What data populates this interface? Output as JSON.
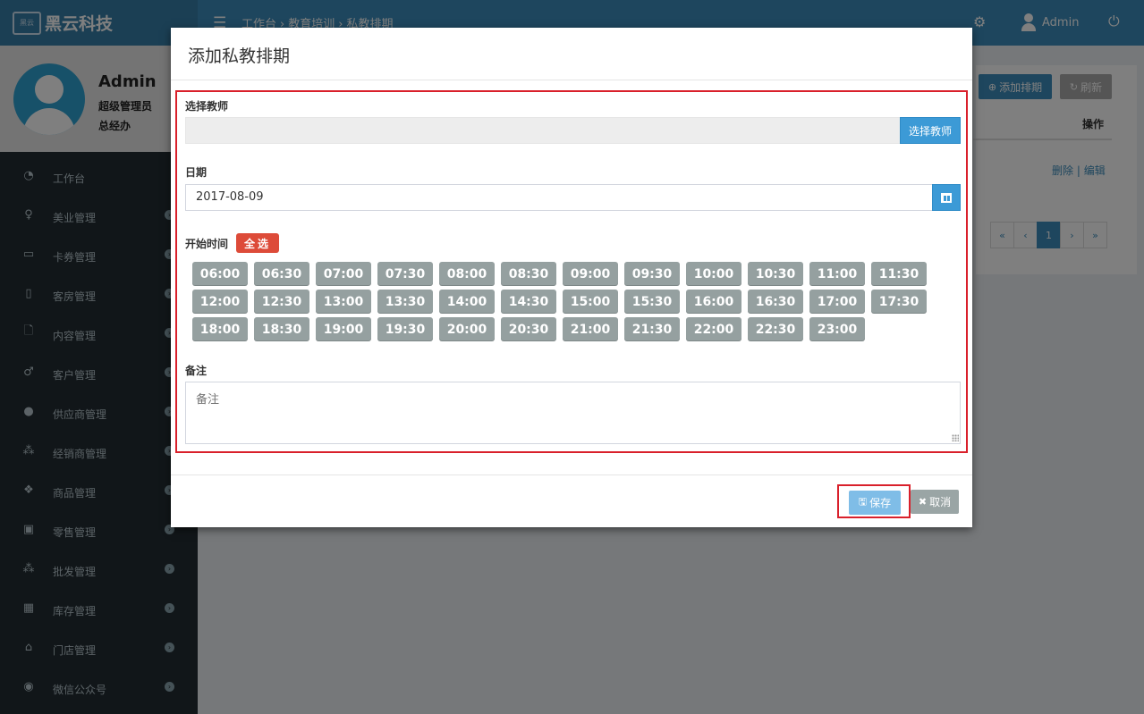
{
  "header": {
    "logo_badge": "黑云",
    "logo_text": "黑云科技",
    "breadcrumb": [
      "工作台",
      "教育培训",
      "私教排期"
    ],
    "user_name": "Admin"
  },
  "sidebar": {
    "profile": {
      "name": "Admin",
      "role": "超级管理员",
      "title": "总经办"
    },
    "items": [
      {
        "label": "工作台",
        "icon": "dashboard-icon",
        "glyph": "◔"
      },
      {
        "label": "美业管理",
        "icon": "female-icon",
        "glyph": "♀"
      },
      {
        "label": "卡券管理",
        "icon": "credit-card-icon",
        "glyph": "▭"
      },
      {
        "label": "客房管理",
        "icon": "building-icon",
        "glyph": "▯"
      },
      {
        "label": "内容管理",
        "icon": "file-icon",
        "glyph": "🗋"
      },
      {
        "label": "客户管理",
        "icon": "male-icon",
        "glyph": "♂"
      },
      {
        "label": "供应商管理",
        "icon": "user-icon",
        "glyph": "●"
      },
      {
        "label": "经销商管理",
        "icon": "users-icon",
        "glyph": "⁂"
      },
      {
        "label": "商品管理",
        "icon": "cubes-icon",
        "glyph": "❖"
      },
      {
        "label": "零售管理",
        "icon": "money-icon",
        "glyph": "▣"
      },
      {
        "label": "批发管理",
        "icon": "group-icon",
        "glyph": "⁂"
      },
      {
        "label": "库存管理",
        "icon": "archive-icon",
        "glyph": "▦"
      },
      {
        "label": "门店管理",
        "icon": "home-icon",
        "glyph": "⌂"
      },
      {
        "label": "微信公众号",
        "icon": "wechat-icon",
        "glyph": "◉"
      }
    ]
  },
  "content": {
    "add_button": "添加排期",
    "refresh_button": "刷新",
    "column_operation": "操作",
    "row_delete": "删除",
    "row_edit": "编辑",
    "pager": [
      "«",
      "‹",
      "1",
      "›",
      "»"
    ]
  },
  "modal": {
    "title": "添加私教排期",
    "teacher_label": "选择教师",
    "teacher_value": "",
    "teacher_button": "选择教师",
    "date_label": "日期",
    "date_value": "2017-08-09",
    "start_time_label": "开始时间",
    "select_all_button": "全选",
    "time_slots": [
      "06:00",
      "06:30",
      "07:00",
      "07:30",
      "08:00",
      "08:30",
      "09:00",
      "09:30",
      "10:00",
      "10:30",
      "11:00",
      "11:30",
      "12:00",
      "12:30",
      "13:00",
      "13:30",
      "14:00",
      "14:30",
      "15:00",
      "15:30",
      "16:00",
      "16:30",
      "17:00",
      "17:30",
      "18:00",
      "18:30",
      "19:00",
      "19:30",
      "20:00",
      "20:30",
      "21:00",
      "21:30",
      "22:00",
      "22:30",
      "23:00"
    ],
    "note_label": "备注",
    "note_placeholder": "备注",
    "save_button": "保存",
    "cancel_button": "取消"
  },
  "colors": {
    "primary": "#3c8dbc",
    "danger": "#dd4b39",
    "slot": "#95a0a0",
    "highlight_frame": "#d9202b"
  }
}
